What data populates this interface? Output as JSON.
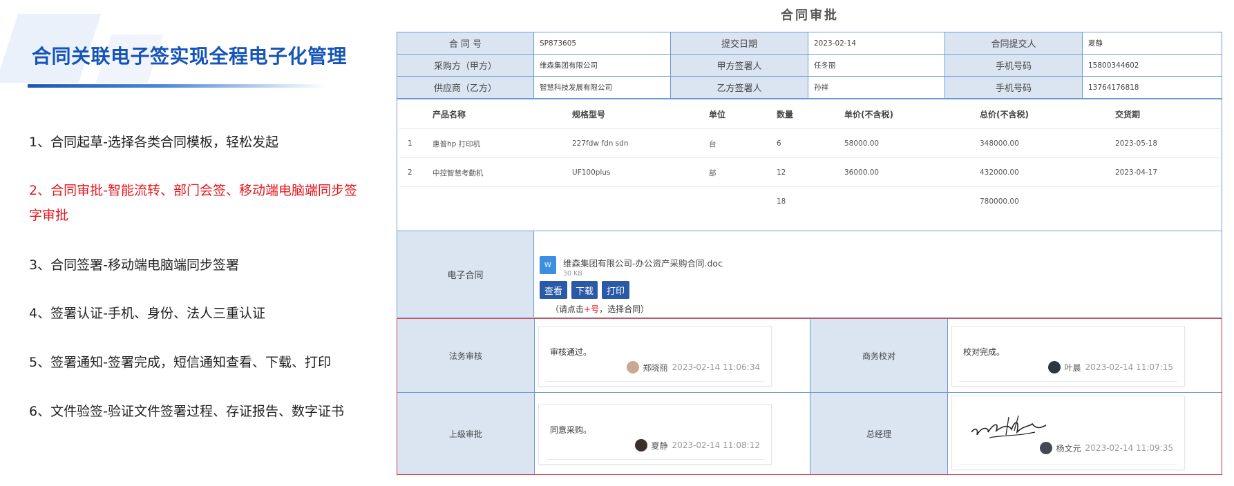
{
  "left": {
    "title": "合同关联电子签实现全程电子化管理",
    "features": [
      {
        "text": "1、合同起草-选择各类合同模板，轻松发起"
      },
      {
        "text": "2、合同审批-智能流转、部门会签、移动端电脑端同步签字审批"
      },
      {
        "text": "3、合同签署-移动端电脑端同步签署"
      },
      {
        "text": "4、签署认证-手机、身份、法人三重认证"
      },
      {
        "text": "5、签署通知-签署完成，短信通知查看、下载、打印"
      },
      {
        "text": "6、文件验签-验证文件签署过程、存证报告、数字证书"
      }
    ]
  },
  "panel": {
    "title": "合同审批",
    "header_rows": [
      [
        {
          "label": "合 同 号"
        },
        {
          "value": "SP873605"
        },
        {
          "label": "提交日期"
        },
        {
          "value": "2023-02-14"
        },
        {
          "label": "合同提交人"
        },
        {
          "value": "夏静"
        }
      ],
      [
        {
          "label": "采购方（甲方）"
        },
        {
          "value": "维森集团有限公司"
        },
        {
          "label": "甲方签署人"
        },
        {
          "value": "任冬丽"
        },
        {
          "label": "手机号码"
        },
        {
          "value": "15800344602"
        }
      ],
      [
        {
          "label": "供应商（乙方）"
        },
        {
          "value": "智慧科技发展有限公司"
        },
        {
          "label": "乙方签署人"
        },
        {
          "value": "孙祥"
        },
        {
          "label": "手机号码"
        },
        {
          "value": "13764176818"
        }
      ]
    ],
    "items_header": [
      "",
      "产品名称",
      "规格型号",
      "单位",
      "数量",
      "单价(不含税)",
      "总价(不含税)",
      "交货期"
    ],
    "items": [
      [
        "1",
        "惠普hp 打印机",
        "227fdw fdn sdn",
        "台",
        "6",
        "58000.00",
        "348000.00",
        "2023-05-18"
      ],
      [
        "2",
        "中控智慧考勤机",
        "UF100plus",
        "部",
        "12",
        "36000.00",
        "432000.00",
        "2023-04-17"
      ]
    ],
    "totals": {
      "qty": "18",
      "amount": "780000.00"
    },
    "econtract": {
      "label": "电子合同",
      "file_icon": "W",
      "file_name": "维森集团有限公司-办公资产采购合同.doc",
      "file_size": "30 KB",
      "view_label": "查看",
      "download_label": "下载",
      "print_label": "打印",
      "hint_pre": "（请点击",
      "hint_plus": "+",
      "hint_mid": "号",
      "hint_post": "，选择合同）"
    },
    "approvals": [
      {
        "label": "法务审核",
        "comment": "审核通过。",
        "name": "郑晓丽",
        "time": "2023-02-14 11:06:34",
        "avatar_color": "#c9a98f"
      },
      {
        "label": "商务校对",
        "comment": "校对完成。",
        "name": "叶晨",
        "time": "2023-02-14 11:07:15",
        "avatar_color": "#2e3642"
      },
      {
        "label": "上级审批",
        "comment": "同意采购。",
        "name": "夏静",
        "time": "2023-02-14 11:08:12",
        "avatar_color": "#3a2f2c"
      },
      {
        "label": "总经理",
        "comment": "",
        "name": "杨文元",
        "time": "2023-02-14 11:09:35",
        "avatar_color": "#444a52"
      }
    ]
  },
  "colors": {
    "brand_blue": "#1554b8",
    "highlight_red": "#e8141b",
    "label_bg": "#dbe5f1",
    "button_blue": "#2a59a8",
    "border_blue": "#6b9bd2",
    "approval_border": "#d9303f"
  }
}
